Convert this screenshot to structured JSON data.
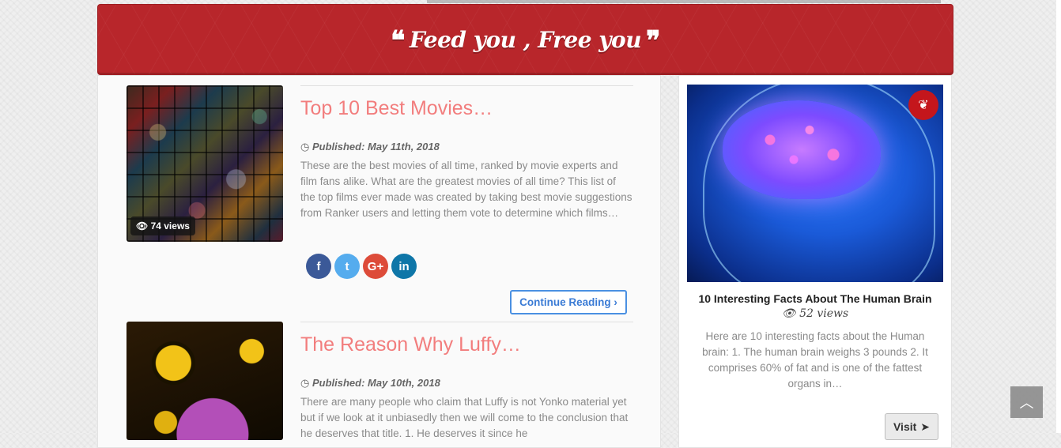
{
  "banner": {
    "open_quote": "❝",
    "text": "Feed you , Free you",
    "close_quote": "❞"
  },
  "posts": [
    {
      "title": "Top 10 Best Movies…",
      "views": "74 views",
      "published": "Published: May 11th, 2018",
      "excerpt": "These are the best movies of all time, ranked by movie experts and film fans alike. What are the greatest movies of all time? This list of the top films ever made was created by taking best movie suggestions from Ranker users and letting them vote to determine which films…",
      "continue_label": "Continue Reading ›"
    },
    {
      "title": "The Reason Why Luffy…",
      "published": "Published: May 10th, 2018",
      "excerpt": "There are many people who claim that Luffy is not Yonko material yet but if we look at it unbiasedly then we will come to the conclusion that he deserves that title. 1. He deserves it since he"
    }
  ],
  "social": {
    "facebook": "f",
    "twitter": "t",
    "google": "G+",
    "linkedin": "in"
  },
  "sidebar": {
    "title": "10 Interesting Facts About The Human Brain",
    "views": "52 views",
    "excerpt": "Here are 10 interesting facts about the Human brain: 1. The human brain weighs 3 pounds 2. It comprises 60% of fat and is one of the fattest organs in…",
    "visit_label": "Visit"
  },
  "icons": {
    "eye": "eye-icon",
    "clock": "clock-icon",
    "leaf": "leaf-icon",
    "send": "paper-plane-icon",
    "up": "chevron-up-icon"
  },
  "colors": {
    "banner": "#b8262b",
    "title": "#f27d7d",
    "link": "#3a7bd5"
  }
}
